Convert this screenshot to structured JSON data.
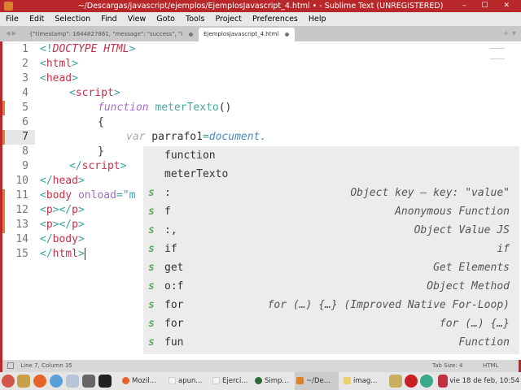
{
  "window": {
    "title": "~/Descargas/javascript/ejemplos/EjemplosJavascript_4.html • - Sublime Text (UNREGISTERED)",
    "controls": "– ☐ ✕"
  },
  "menu": [
    "File",
    "Edit",
    "Selection",
    "Find",
    "View",
    "Goto",
    "Tools",
    "Project",
    "Preferences",
    "Help"
  ],
  "tabs": [
    {
      "label": "{\"timestamp\": 1644827861, \"message\": \"success\", \"i"
    },
    {
      "label": "EjemplosJavascript_4.html",
      "active": true
    }
  ],
  "tab_nav": "◀ ▶",
  "tab_plus": "+ ▾",
  "editor": {
    "line_numbers": [
      "1",
      "2",
      "3",
      "4",
      "5",
      "6",
      "7",
      "8",
      "9",
      "10",
      "11",
      "12",
      "13",
      "14",
      "15"
    ],
    "current_line": "7"
  },
  "code": {
    "l1": [
      "<!",
      "DOCTYPE",
      " HTML",
      ">"
    ],
    "l2": [
      "<",
      "html",
      ">"
    ],
    "l3": [
      "<",
      "head",
      ">"
    ],
    "l4": [
      "<",
      "script",
      ">"
    ],
    "l5": [
      "function",
      " meterTexto",
      "()"
    ],
    "l6": "{",
    "l7": [
      "var",
      " parrafo1",
      "=",
      "document",
      "."
    ],
    "l8": "}",
    "l9": [
      "</",
      "script",
      ">"
    ],
    "l10": [
      "</",
      "head",
      ">"
    ],
    "l11": [
      "<",
      "body",
      " onload",
      "=\"m"
    ],
    "l12": [
      "<",
      "p",
      "></",
      "p",
      ">"
    ],
    "l13": [
      "<",
      "p",
      "></",
      "p",
      ">"
    ],
    "l14": [
      "</",
      "body",
      ">"
    ],
    "l15": [
      "</",
      "html",
      ">"
    ]
  },
  "autocomplete": [
    {
      "kind": "",
      "text": "function",
      "desc": ""
    },
    {
      "kind": "",
      "text": "meterTexto",
      "desc": ""
    },
    {
      "kind": "s",
      "text": ":",
      "desc": "Object key — key: \"value\""
    },
    {
      "kind": "s",
      "text": "f",
      "desc": "Anonymous Function"
    },
    {
      "kind": "s",
      "text": ":,",
      "desc": "Object Value JS"
    },
    {
      "kind": "s",
      "text": "if",
      "desc": "if"
    },
    {
      "kind": "s",
      "text": "get",
      "desc": "Get Elements"
    },
    {
      "kind": "s",
      "text": "o:f",
      "desc": "Object Method"
    },
    {
      "kind": "s",
      "text": "for",
      "desc": "for (…) {…} (Improved Native For-Loop)"
    },
    {
      "kind": "s",
      "text": "for",
      "desc": "for (…) {…}"
    },
    {
      "kind": "s",
      "text": "fun",
      "desc": "Function"
    }
  ],
  "status": {
    "position": "Line 7, Column 35",
    "tab_size": "Tab Size: 4",
    "syntax": "HTML"
  },
  "taskbar": {
    "windows": [
      "Mozil...",
      "apun...",
      "Ejerci...",
      "Simp...",
      "~/De...",
      "imag..."
    ],
    "clock": "vie 18 de feb, 10:54"
  },
  "colors": {
    "titlebar": "#b8282a",
    "accent": "#e87a2c"
  }
}
